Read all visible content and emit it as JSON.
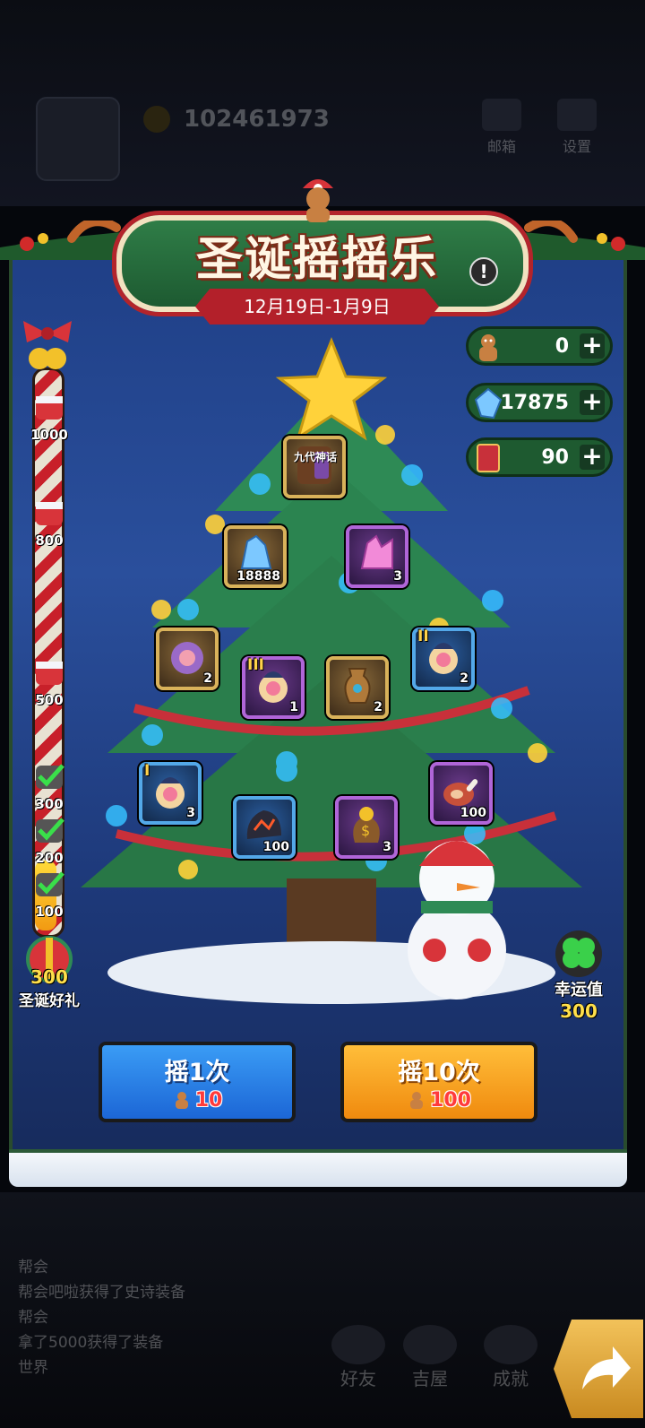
{
  "background": {
    "player_id": "102461973",
    "mail_label": "邮箱",
    "settings_label": "设置",
    "chat_lines": [
      "帮会",
      "帮会吧啦获得了史诗装备",
      "帮会",
      "拿了5000获得了装备",
      "世界"
    ],
    "nav": {
      "friends": "好友",
      "guild": "吉屋",
      "achievements": "成就"
    }
  },
  "event": {
    "title": "圣诞摇摇乐",
    "date_range": "12月19日-1月9日",
    "info_icon": "!"
  },
  "resources": [
    {
      "name": "gingerbread",
      "value": "0"
    },
    {
      "name": "crystal",
      "value": "17875"
    },
    {
      "name": "ticket",
      "value": "90"
    }
  ],
  "milestones": [
    "1000",
    "800",
    "500",
    "300",
    "200",
    "100"
  ],
  "gift": {
    "count": "300",
    "label": "圣诞好礼"
  },
  "luck": {
    "label": "幸运值",
    "value": "300"
  },
  "rewards": {
    "myth": {
      "text": "九代神话"
    },
    "crystal": {
      "qty": "18888"
    },
    "pinkgem": {
      "qty": "3"
    },
    "box_plain": {
      "qty": "2"
    },
    "box_3": {
      "tier": "III",
      "qty": "1"
    },
    "urn": {
      "qty": "2"
    },
    "box_2": {
      "tier": "II",
      "qty": "2"
    },
    "box_1": {
      "tier": "I",
      "qty": "3"
    },
    "stone": {
      "qty": "100"
    },
    "gold": {
      "qty": "3"
    },
    "meat": {
      "qty": "100"
    }
  },
  "buttons": {
    "shake1": {
      "label": "摇1次",
      "cost": "10"
    },
    "shake10": {
      "label": "摇10次",
      "cost": "100"
    }
  },
  "colors": {
    "panel": "#1f3f86",
    "button_blue": "#2a82e8",
    "button_orange": "#f7a52a",
    "cost_red": "#ff3b3b"
  }
}
